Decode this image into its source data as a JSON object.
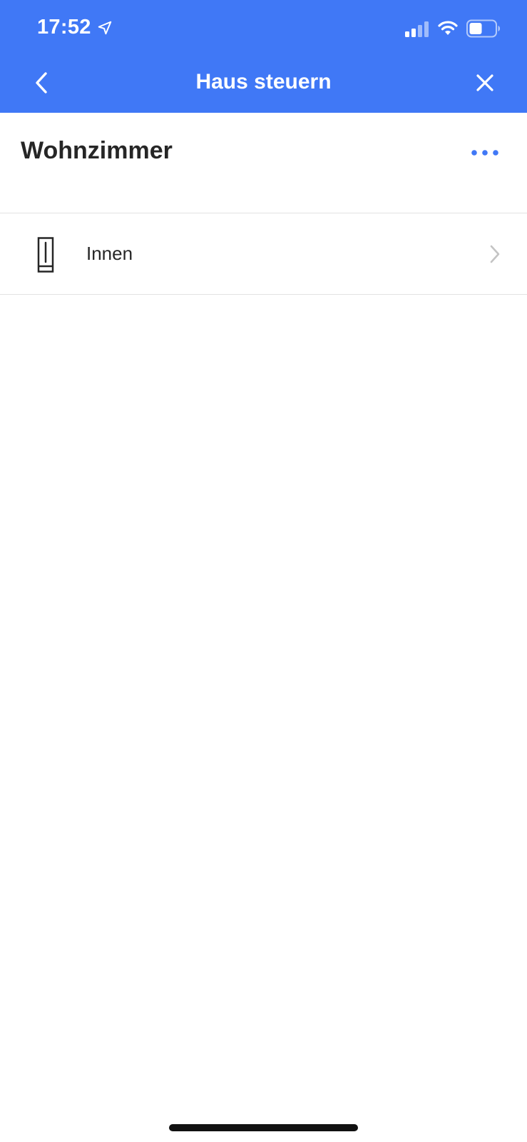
{
  "status_bar": {
    "time": "17:52",
    "location_icon": "location-arrow-icon",
    "signal_icon": "cellular-signal-icon",
    "wifi_icon": "wifi-icon",
    "battery_icon": "battery-icon"
  },
  "nav": {
    "title": "Haus steuern",
    "back_icon": "chevron-left-icon",
    "close_icon": "close-icon"
  },
  "room": {
    "title": "Wohnzimmer",
    "more_icon": "more-horizontal-icon"
  },
  "items": [
    {
      "label": "Innen",
      "icon": "window-blind-icon",
      "chevron_icon": "chevron-right-icon"
    }
  ],
  "colors": {
    "header_blue": "#4078f6",
    "accent_blue": "#4078f6",
    "text_dark": "#262626",
    "divider": "#e3e3e3",
    "chevron_gray": "#c4c4c4"
  }
}
